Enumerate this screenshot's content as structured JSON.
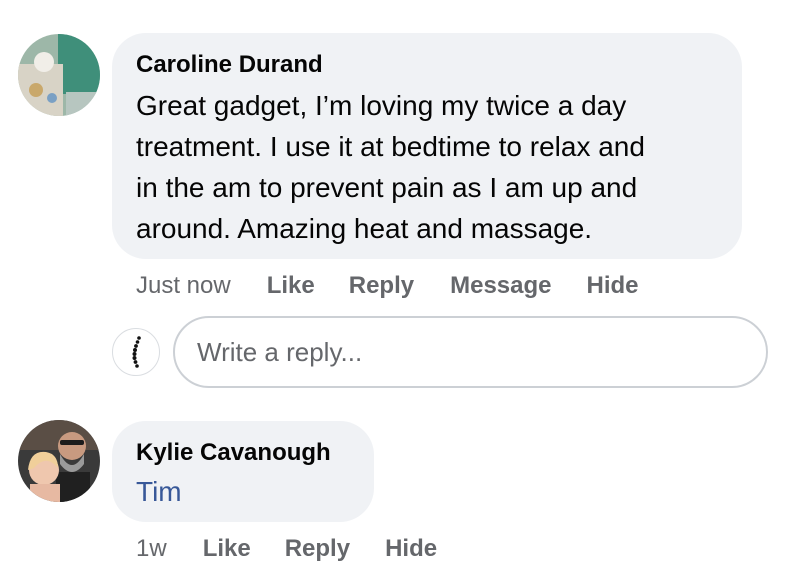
{
  "comments": [
    {
      "author": "Caroline Durand",
      "text": "Great gadget, I’m loving my twice a day treatment.  I use it at bedtime to relax and in the am to prevent pain as I am up and around.  Amazing heat and massage.",
      "lines": [
        "Great gadget, I’m loving my twice a day",
        "treatment.  I use it at bedtime to relax and",
        "in the am to prevent pain as I am up and",
        "around.  Amazing heat and massage."
      ],
      "time": "Just now",
      "actions": {
        "like": "Like",
        "reply": "Reply",
        "message": "Message",
        "hide": "Hide"
      }
    },
    {
      "author": "Kylie Cavanough",
      "mention": "Tim",
      "time": "1w",
      "actions": {
        "like": "Like",
        "reply": "Reply",
        "hide": "Hide"
      }
    }
  ],
  "reply_composer": {
    "placeholder": "Write a reply..."
  },
  "colors": {
    "bubble": "#f0f2f5",
    "text": "#050505",
    "secondary": "#65676b",
    "mention": "#385898",
    "border": "#ccd0d5"
  }
}
